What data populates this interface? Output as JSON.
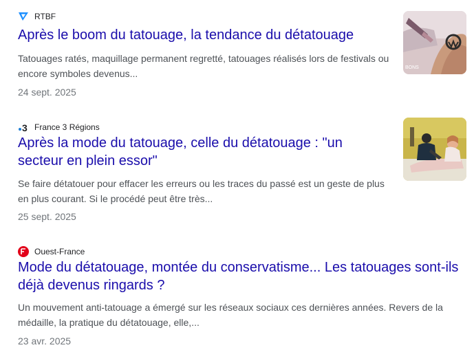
{
  "articles": [
    {
      "source": "RTBF",
      "source_icon": "rtbf-logo-icon",
      "title": "Après le boom du tatouage, la tendance du détatouage",
      "snippet": "Tatouages ratés, maquillage permanent regretté, tatouages réalisés lors de festivals ou encore symboles devenus...",
      "date": "24 sept. 2025",
      "thumbnail": "tattoo-removal-arm-thumbnail",
      "thumbnail_caption": "BONS"
    },
    {
      "source": "France 3 Régions",
      "source_icon": "france3-logo-icon",
      "title": "Après la mode du tatouage, celle du détatouage : \"un secteur en plein essor\"",
      "snippet": "Se faire détatouer pour effacer les erreurs ou les traces du passé est un geste de plus en plus courant. Si le procédé peut être très...",
      "date": "25 sept. 2025",
      "thumbnail": "clinic-laser-session-thumbnail"
    },
    {
      "source": "Ouest-France",
      "source_icon": "ouest-france-logo-icon",
      "title": "Mode du détatouage, montée du conservatisme... Les tatouages sont-ils déjà devenus ringards ?",
      "snippet": "Un mouvement anti-tatouage a émergé sur les réseaux sociaux ces dernières années. Revers de la médaille, la pratique du détatouage, elle,...",
      "date": "23 avr. 2025"
    }
  ],
  "colors": {
    "headline": "#1a0dab",
    "snippet": "#4d5156",
    "date": "#70757a",
    "rtbf_blue": "#1e90ff",
    "ouest_france_red": "#e2001a"
  }
}
